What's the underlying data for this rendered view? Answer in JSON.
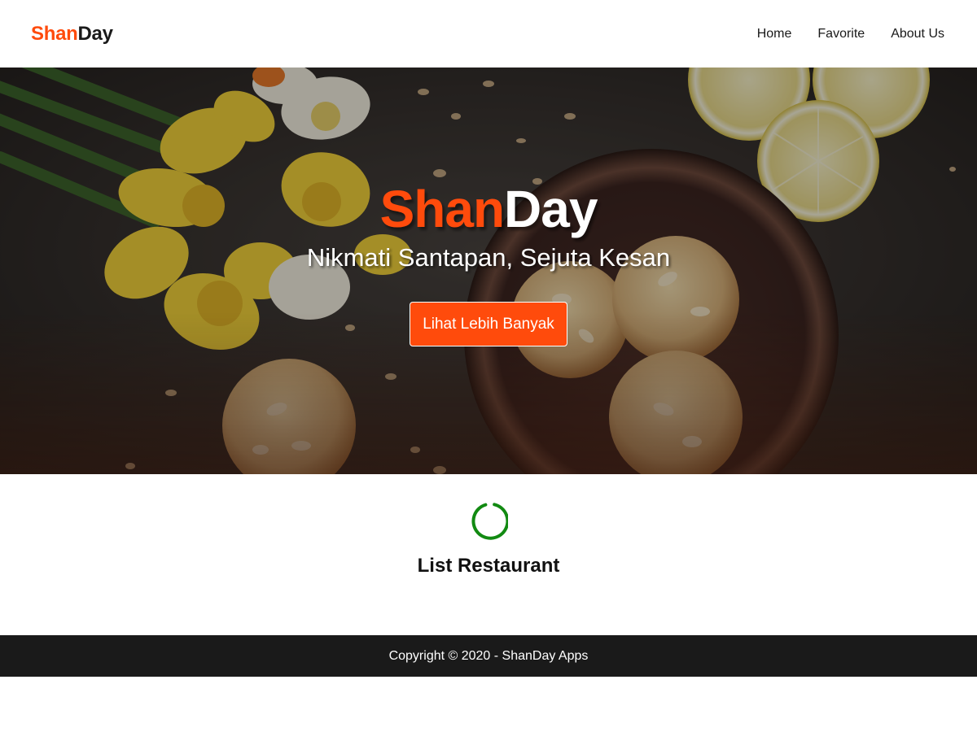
{
  "header": {
    "logo_part1": "Shan",
    "logo_part2": "Day",
    "nav": [
      "Home",
      "Favorite",
      "About Us"
    ]
  },
  "hero": {
    "title_part1": "Shan",
    "title_part2": "Day",
    "tagline": "Nikmati Santapan, Sejuta Kesan",
    "button_label": "Lihat Lebih Banyak"
  },
  "main": {
    "loading_icon": "spinner-icon",
    "section_title": "List Restaurant"
  },
  "footer": {
    "copyright": "Copyright © 2020 - ShanDay Apps"
  },
  "colors": {
    "brand_accent": "#ff4b0c",
    "text_dark": "#1a1a1a",
    "footer_bg": "#1a1a1a",
    "spinner": "#128a12"
  }
}
